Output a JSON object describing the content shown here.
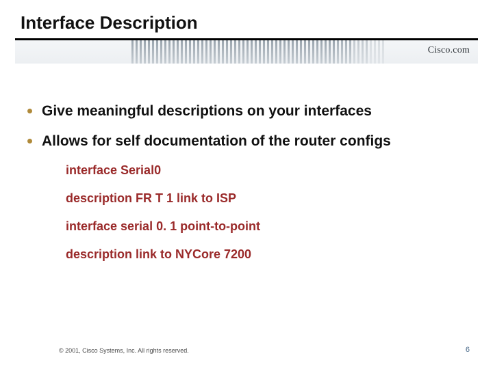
{
  "title": "Interface Description",
  "brand": "Cisco.com",
  "bullets": [
    "Give meaningful descriptions on your interfaces",
    "Allows for self documentation of the router configs"
  ],
  "code": [
    "interface Serial0",
    "description FR T 1 link to ISP",
    "interface serial 0. 1 point-to-point",
    "description link to NYCore 7200"
  ],
  "footer": {
    "copyright": "© 2001, Cisco Systems, Inc. All rights reserved.",
    "page": "6"
  }
}
